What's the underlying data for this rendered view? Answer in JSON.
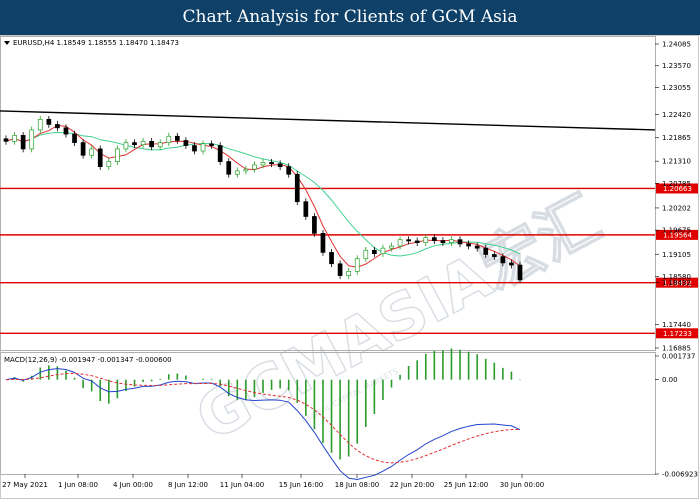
{
  "banner": {
    "title": "Chart Analysis for Clients of GCM Asia"
  },
  "watermark": {
    "text": "GCMASIA宏汇",
    "subtext": "GLOBAL CAPITAL MARKETS"
  },
  "symbol_info": "EURUSD,H4  1.18549 1.18555 1.18470 1.18473",
  "macd_info": "MACD(12,26,9) -0.001947 -0.001347 -0.000600",
  "chart_data": [
    {
      "type": "candlestick",
      "title": "",
      "instrument": "EURUSD",
      "timeframe": "H4",
      "ohlc_current": {
        "open": 1.18549,
        "high": 1.18555,
        "low": 1.1847,
        "close": 1.18473
      },
      "y_ticks": [
        1.24085,
        1.2357,
        1.23055,
        1.2242,
        1.21865,
        1.2131,
        1.20785,
        1.20202,
        1.19675,
        1.19105,
        1.1858,
        1.18432,
        1.1744,
        1.16885
      ],
      "ylim": [
        1.16885,
        1.24085
      ],
      "x_ticks": [
        "27 May 2021",
        "1 Jun 08:00",
        "4 Jun 00:00",
        "8 Jun 12:00",
        "11 Jun 04:00",
        "15 Jun 16:00",
        "18 Jun 08:00",
        "22 Jun 20:00",
        "25 Jun 12:00",
        "30 Jun 00:00"
      ],
      "levels": [
        {
          "value": 1.20663,
          "label": "1.20663",
          "color": "#e00000"
        },
        {
          "value": 1.19564,
          "label": "1.19564",
          "color": "#e00000"
        },
        {
          "value": 1.18432,
          "label": "1.18432",
          "color": "#e00000"
        },
        {
          "value": 1.17233,
          "label": "1.17233",
          "color": "#e00000"
        }
      ],
      "trendline": {
        "start": 1.225,
        "end": 1.2205,
        "color": "#000000"
      },
      "close_series": [
        1.2178,
        1.2192,
        1.216,
        1.2205,
        1.223,
        1.2218,
        1.221,
        1.2195,
        1.2175,
        1.2145,
        1.216,
        1.2118,
        1.213,
        1.216,
        1.2175,
        1.217,
        1.2178,
        1.2165,
        1.2175,
        1.219,
        1.218,
        1.2168,
        1.2155,
        1.2172,
        1.2168,
        1.213,
        1.21,
        1.2108,
        1.2112,
        1.2122,
        1.2128,
        1.2125,
        1.2118,
        1.21,
        1.2035,
        1.2,
        1.196,
        1.1915,
        1.1888,
        1.186,
        1.187,
        1.19,
        1.192,
        1.1912,
        1.1925,
        1.193,
        1.1945,
        1.1942,
        1.1938,
        1.195,
        1.1943,
        1.1938,
        1.1945,
        1.1935,
        1.193,
        1.1925,
        1.191,
        1.1905,
        1.189,
        1.1885,
        1.185
      ],
      "ma_fast_color": "#e03030",
      "ma_slow_color": "#40d090",
      "candle_up_color": "#2aa02a",
      "candle_down_color": "#000000",
      "current_price": 1.18432
    },
    {
      "type": "macd",
      "title": "",
      "params": [
        12,
        26,
        9
      ],
      "values": {
        "macd": -0.001947,
        "signal": -0.001347,
        "histogram": -0.0006
      },
      "y_ticks": [
        0.001737,
        0.0,
        -0.006923
      ],
      "y_tick_labels": [
        "0.001737",
        "0.00",
        "-0.006923"
      ],
      "ylim": [
        -0.006923,
        0.001737
      ],
      "line_color": "#2244cc",
      "signal_color": "#e03030",
      "histogram_color": "#2a9a2a"
    }
  ]
}
